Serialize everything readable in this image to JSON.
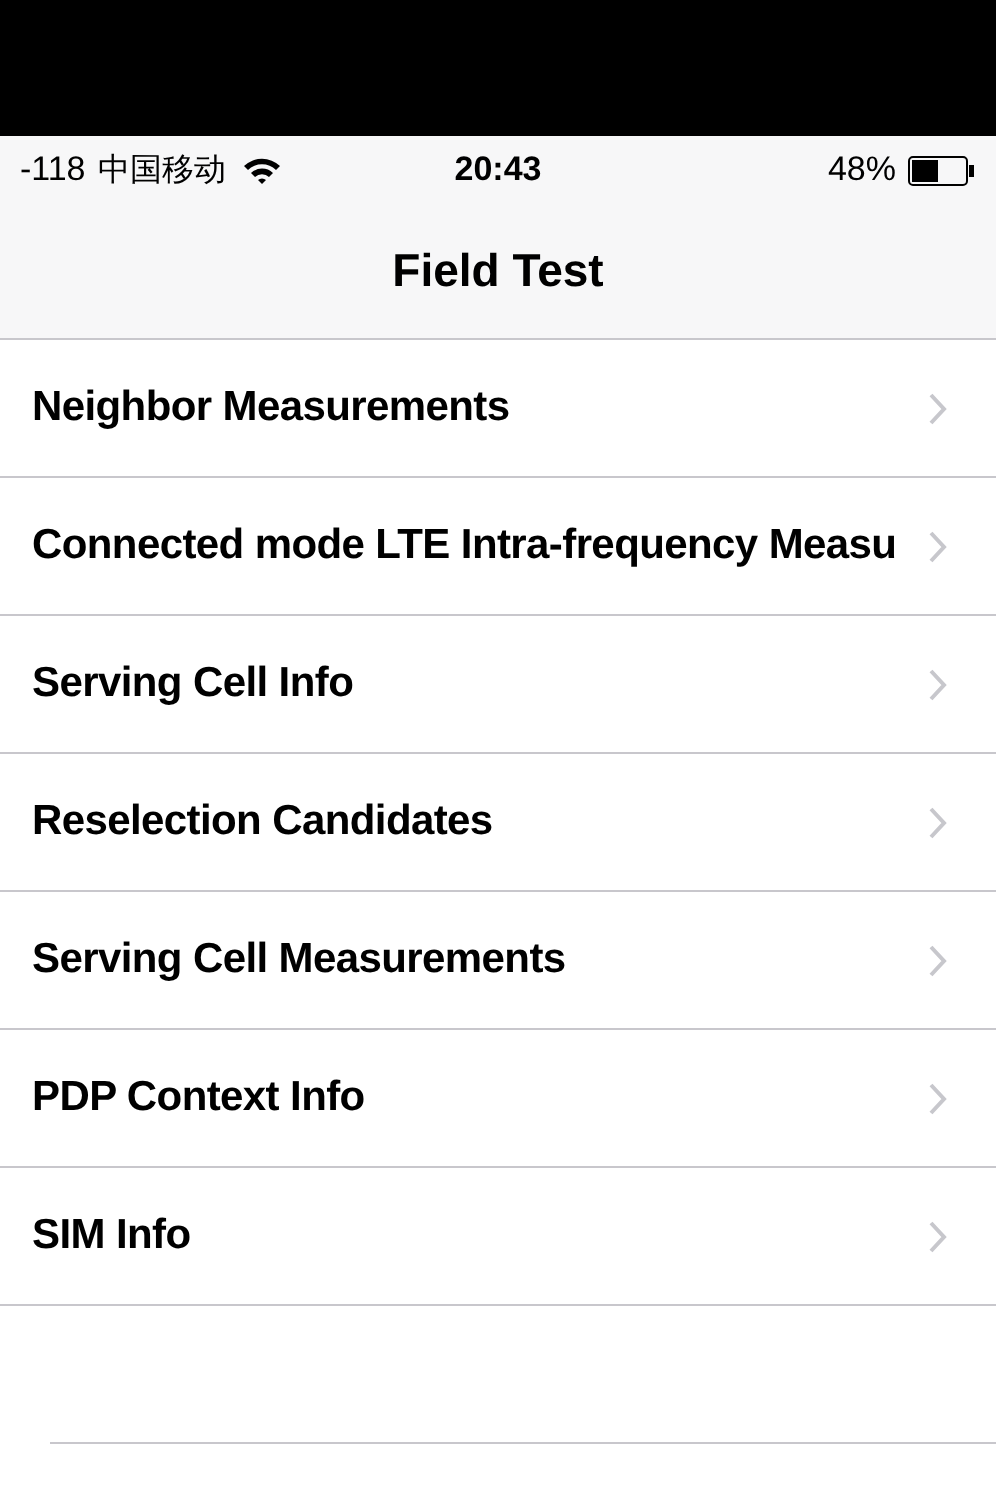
{
  "status_bar": {
    "signal": "-118",
    "carrier": "中国移动",
    "time": "20:43",
    "battery": "48%"
  },
  "nav": {
    "title": "Field Test"
  },
  "items": [
    {
      "label": "Neighbor Measurements"
    },
    {
      "label": "Connected mode LTE Intra-frequency Measu"
    },
    {
      "label": "Serving Cell Info"
    },
    {
      "label": "Reselection Candidates"
    },
    {
      "label": "Serving Cell Measurements"
    },
    {
      "label": "PDP Context Info"
    },
    {
      "label": "SIM Info"
    }
  ]
}
